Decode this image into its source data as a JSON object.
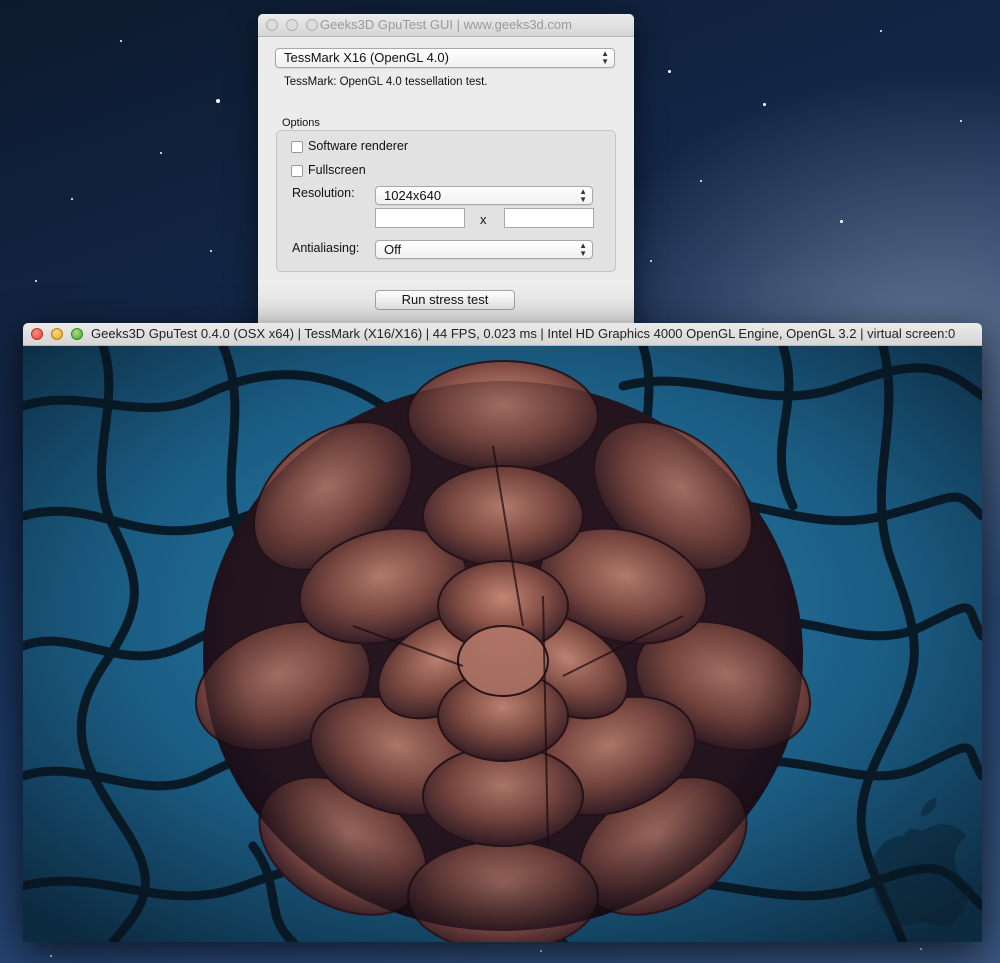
{
  "gui_window": {
    "title": "Geeks3D GpuTest GUI | www.geeks3d.com",
    "test_select": "TessMark X16 (OpenGL 4.0)",
    "test_description": "TessMark: OpenGL 4.0 tessellation test.",
    "options_label": "Options",
    "software_renderer_label": "Software renderer",
    "software_renderer_checked": false,
    "fullscreen_label": "Fullscreen",
    "fullscreen_checked": false,
    "resolution_label": "Resolution:",
    "resolution_value": "1024x640",
    "width_value": "",
    "x_separator": "x",
    "height_value": "",
    "antialiasing_label": "Antialiasing:",
    "antialiasing_value": "Off",
    "run_button": "Run stress test"
  },
  "render_window": {
    "title": "Geeks3D GpuTest 0.4.0 (OSX x64) | TessMark (X16/X16) | 44 FPS, 0.023 ms | Intel HD Graphics 4000 OpenGL Engine, OpenGL 3.2 | virtual screen:0"
  },
  "icons": [
    "close-light-icon",
    "minimize-light-icon",
    "maximize-light-icon",
    "select-arrows-icon",
    "apple-logo-icon"
  ],
  "colors": {
    "render_background": "#1a5a80",
    "cell_borders": "#081520",
    "flower_petals": "#8a5248"
  }
}
